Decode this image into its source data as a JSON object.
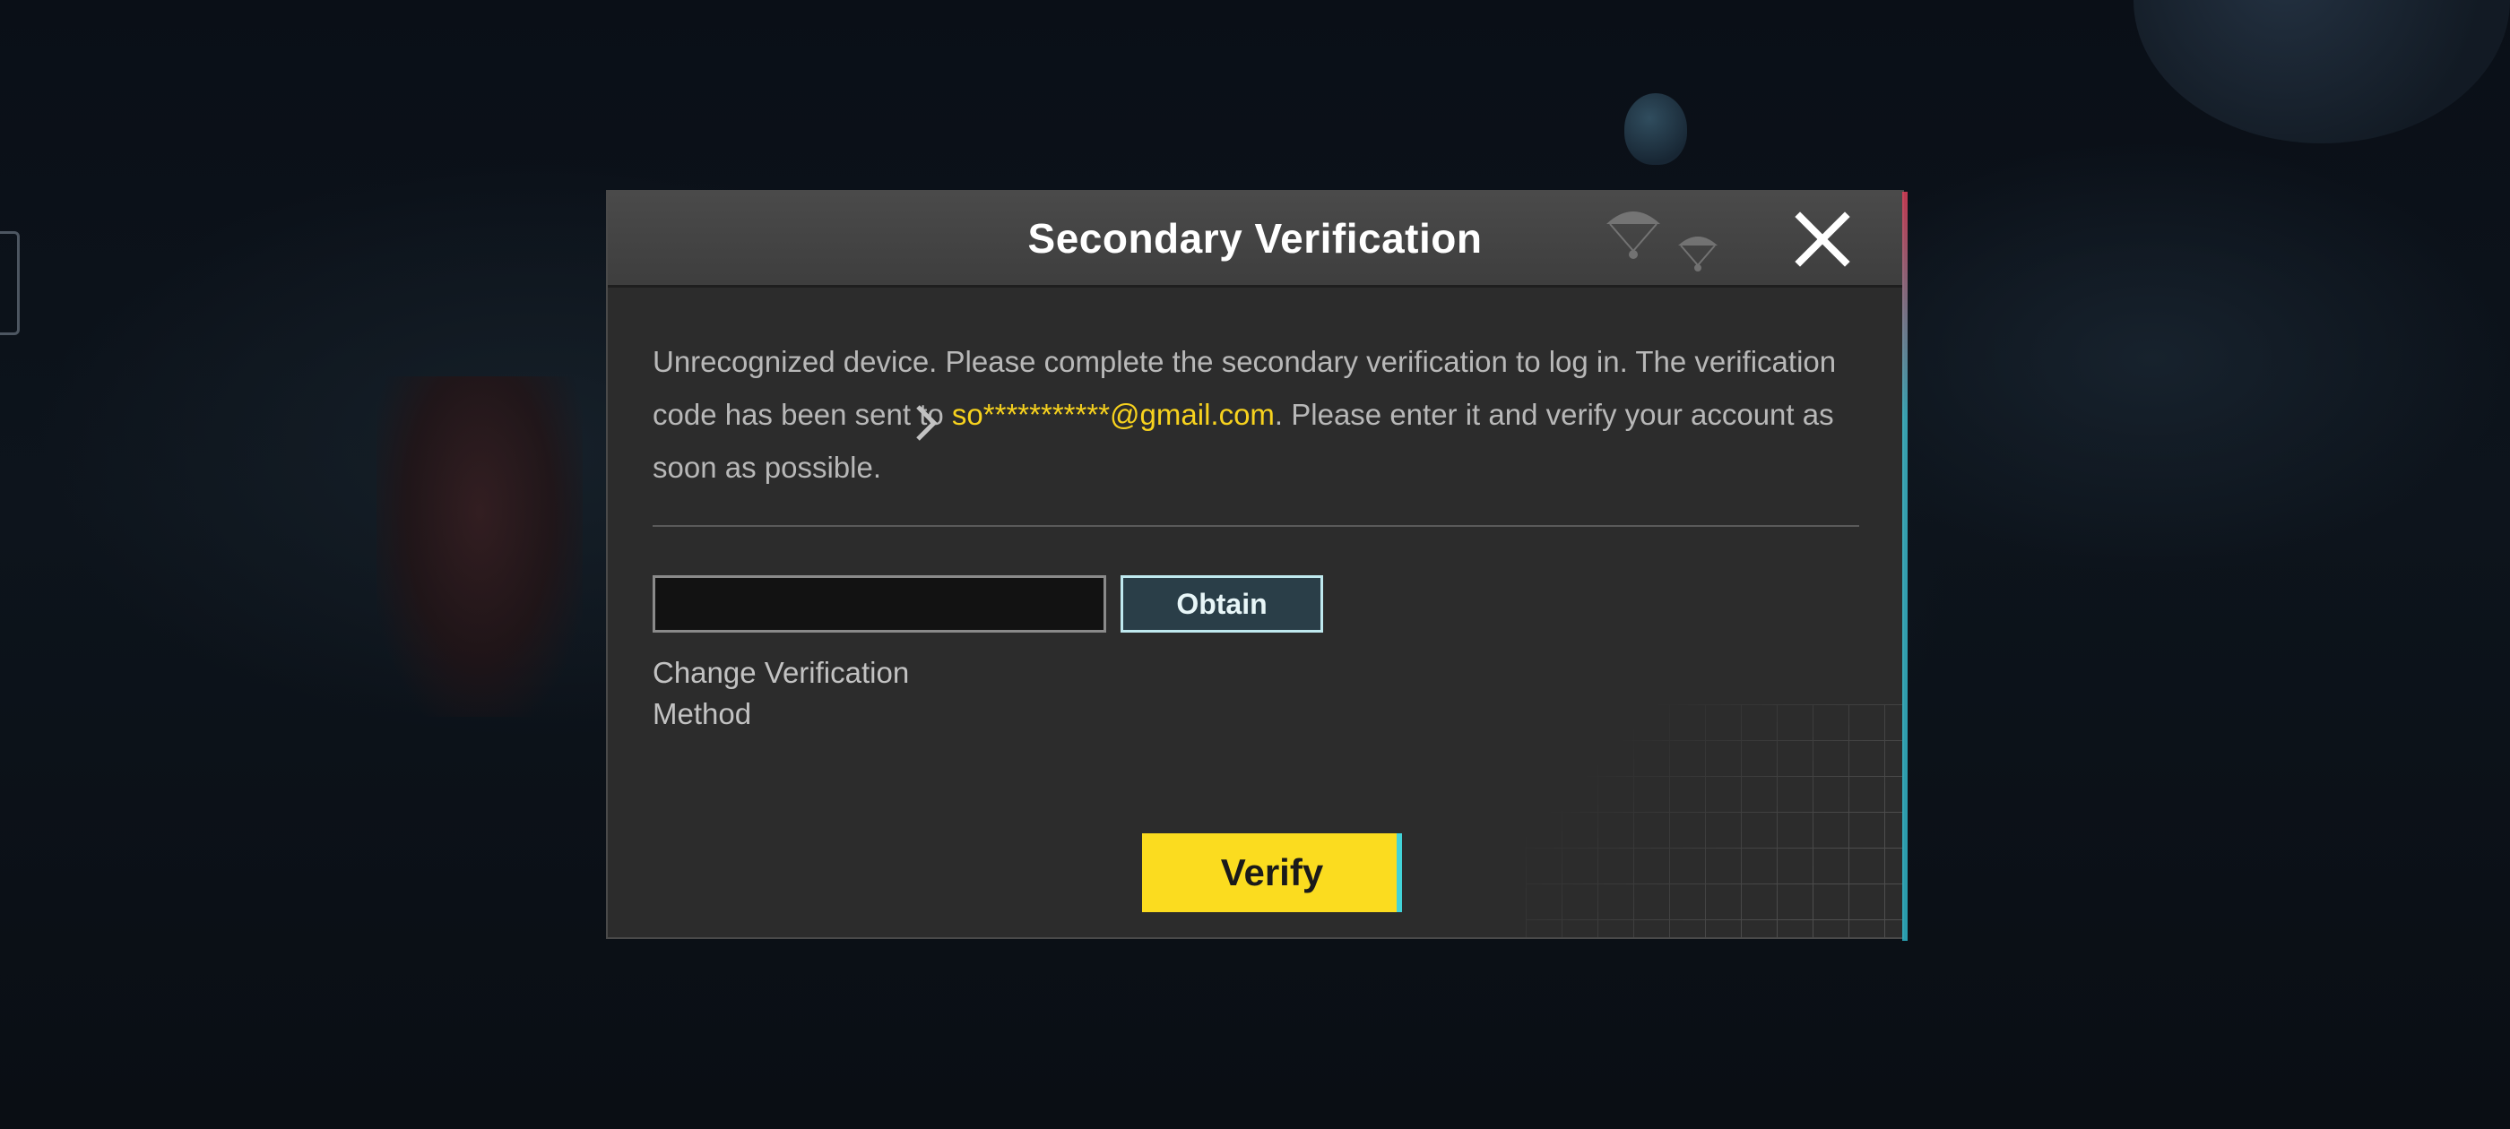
{
  "dialog": {
    "title": "Secondary Verification",
    "close_icon": "close-icon",
    "message": {
      "before_email": "Unrecognized device. Please complete the secondary verification to log in. The verification code has been sent to ",
      "email": "so***********@gmail.com",
      "after_email": ". Please enter it and verify your account as soon as possible."
    },
    "code_input": {
      "value": "",
      "placeholder": ""
    },
    "obtain_label": "Obtain",
    "change_method_label": "Change Verification Method",
    "chevron_icon": "chevron-right-icon",
    "verify_label": "Verify"
  },
  "colors": {
    "dialog_bg": "#2c2c2c",
    "email_highlight": "#f7d21e",
    "verify_button": "#fbdc1f",
    "obtain_border": "#bfe9ef"
  }
}
